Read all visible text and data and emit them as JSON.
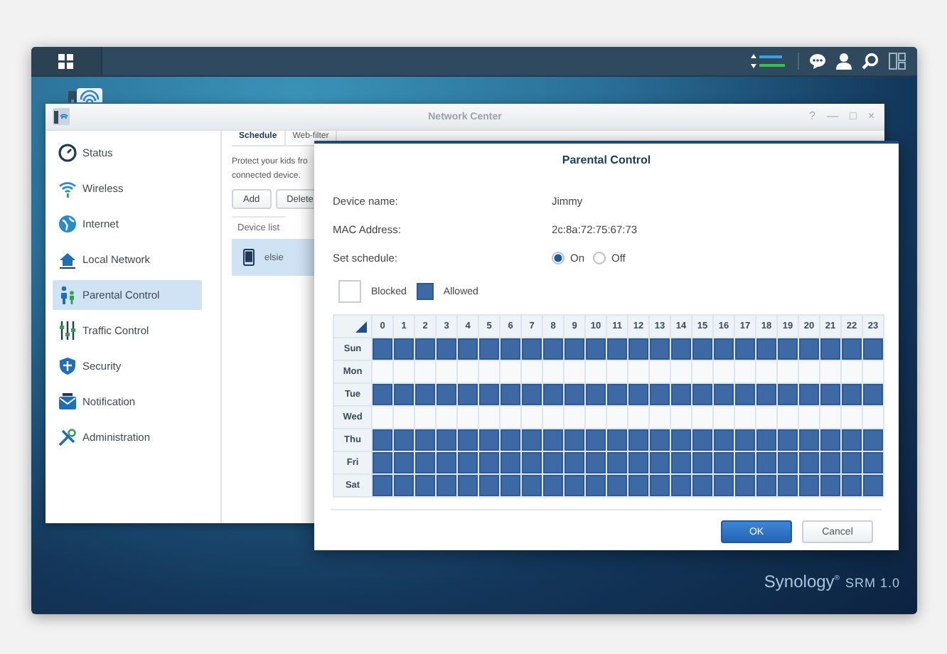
{
  "window": {
    "title": "Network Center",
    "controls": [
      "?",
      "—",
      "□",
      "×"
    ]
  },
  "sidebar": {
    "items": [
      {
        "label": "Status",
        "selected": false
      },
      {
        "label": "Wireless",
        "selected": false
      },
      {
        "label": "Internet",
        "selected": false
      },
      {
        "label": "Local Network",
        "selected": false
      },
      {
        "label": "Parental Control",
        "selected": true
      },
      {
        "label": "Traffic Control",
        "selected": false
      },
      {
        "label": "Security",
        "selected": false
      },
      {
        "label": "Notification",
        "selected": false
      },
      {
        "label": "Administration",
        "selected": false
      }
    ]
  },
  "tabs": [
    {
      "label": "Schedule",
      "selected": true
    },
    {
      "label": "Web-filter",
      "selected": false
    }
  ],
  "description": [
    "Protect your kids fro",
    "connected device."
  ],
  "toolbar": [
    "Add",
    "Delete"
  ],
  "device_list": {
    "header": "Device list",
    "rows": [
      {
        "name": "elsie",
        "selected": true
      }
    ]
  },
  "dialog": {
    "title": "Parental Control",
    "fields": [
      {
        "label": "Device name:",
        "value": "Jimmy"
      },
      {
        "label": "MAC Address:",
        "value": "2c:8a:72:75:67:73"
      }
    ],
    "schedule_label": "Set schedule:",
    "schedule_options": [
      {
        "label": "On",
        "selected": true
      },
      {
        "label": "Off",
        "selected": false
      }
    ],
    "legend": [
      {
        "label": "Blocked",
        "allowed": false
      },
      {
        "label": "Allowed",
        "allowed": true
      }
    ],
    "hours": [
      "0",
      "1",
      "2",
      "3",
      "4",
      "5",
      "6",
      "7",
      "8",
      "9",
      "10",
      "11",
      "12",
      "13",
      "14",
      "15",
      "16",
      "17",
      "18",
      "19",
      "20",
      "21",
      "22",
      "23"
    ],
    "days": [
      {
        "day": "Sun",
        "allowed": [
          true,
          true,
          true,
          true,
          true,
          true,
          true,
          true,
          true,
          true,
          true,
          true,
          true,
          true,
          true,
          true,
          true,
          true,
          true,
          true,
          true,
          true,
          true,
          true
        ]
      },
      {
        "day": "Mon",
        "allowed": [
          false,
          false,
          false,
          false,
          false,
          false,
          false,
          false,
          false,
          false,
          false,
          false,
          false,
          false,
          false,
          false,
          false,
          false,
          false,
          false,
          false,
          false,
          false,
          false
        ]
      },
      {
        "day": "Tue",
        "allowed": [
          true,
          true,
          true,
          true,
          true,
          true,
          true,
          true,
          true,
          true,
          true,
          true,
          true,
          true,
          true,
          true,
          true,
          true,
          true,
          true,
          true,
          true,
          true,
          true
        ]
      },
      {
        "day": "Wed",
        "allowed": [
          false,
          false,
          false,
          false,
          false,
          false,
          false,
          false,
          false,
          false,
          false,
          false,
          false,
          false,
          false,
          false,
          false,
          false,
          false,
          false,
          false,
          false,
          false,
          false
        ]
      },
      {
        "day": "Thu",
        "allowed": [
          true,
          true,
          true,
          true,
          true,
          true,
          true,
          true,
          true,
          true,
          true,
          true,
          true,
          true,
          true,
          true,
          true,
          true,
          true,
          true,
          true,
          true,
          true,
          true
        ]
      },
      {
        "day": "Fri",
        "allowed": [
          true,
          true,
          true,
          true,
          true,
          true,
          true,
          true,
          true,
          true,
          true,
          true,
          true,
          true,
          true,
          true,
          true,
          true,
          true,
          true,
          true,
          true,
          true,
          true
        ]
      },
      {
        "day": "Sat",
        "allowed": [
          true,
          true,
          true,
          true,
          true,
          true,
          true,
          true,
          true,
          true,
          true,
          true,
          true,
          true,
          true,
          true,
          true,
          true,
          true,
          true,
          true,
          true,
          true,
          true
        ]
      }
    ],
    "buttons": [
      {
        "label": "OK",
        "kind": "primary"
      },
      {
        "label": "Cancel",
        "kind": "secondary"
      }
    ]
  },
  "brand": {
    "name": "Synology",
    "mark": "®",
    "product": "SRM 1.0"
  }
}
